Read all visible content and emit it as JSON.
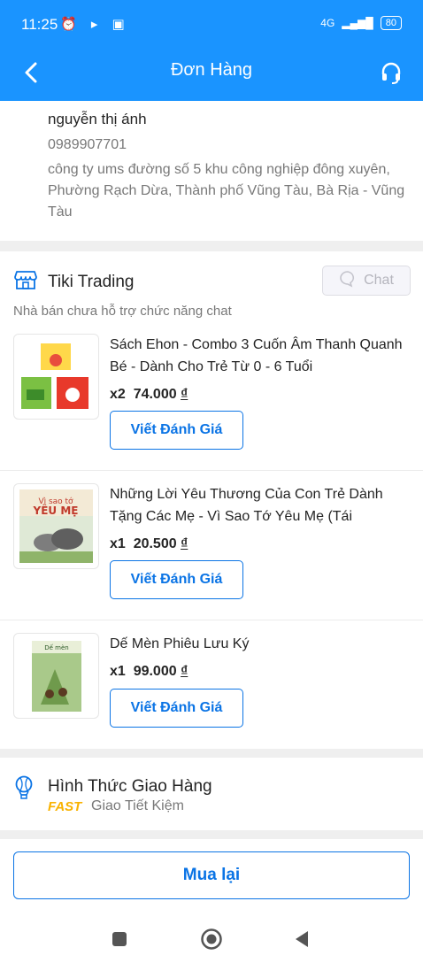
{
  "status_bar": {
    "time": "11:25",
    "battery": "80",
    "network": "4G"
  },
  "header": {
    "title": "Đơn Hàng"
  },
  "address": {
    "name": "nguyễn thị ánh",
    "phone": "0989907701",
    "full": "công ty ums đường số 5 khu công nghiệp đông xuyên, Phường Rạch Dừa, Thành phố Vũng Tàu, Bà Rịa - Vũng Tàu"
  },
  "seller": {
    "name": "Tiki Trading",
    "chat_label": "Chat",
    "note": "Nhà bán chưa hỗ trợ chức năng chat"
  },
  "items": [
    {
      "title": "Sách Ehon - Combo 3 Cuốn Âm Thanh Quanh Bé - Dành Cho Trẻ Từ 0 - 6 Tuổi",
      "qty": "x2",
      "price": "74.000",
      "currency": "₫",
      "review_label": "Viết Đánh Giá"
    },
    {
      "title": "Những Lời Yêu Thương Của Con Trẻ Dành Tặng Các Mẹ - Vì Sao Tớ Yêu Mẹ (Tái",
      "qty": "x1",
      "price": "20.500",
      "currency": "₫",
      "review_label": "Viết Đánh Giá"
    },
    {
      "title": "Dế Mèn Phiêu Lưu Ký",
      "qty": "x1",
      "price": "99.000",
      "currency": "₫",
      "review_label": "Viết Đánh Giá"
    }
  ],
  "shipping": {
    "title": "Hình Thức Giao Hàng",
    "badge": "FAST",
    "method": "Giao Tiết Kiệm"
  },
  "actions": {
    "buy_again": "Mua lại"
  },
  "colors": {
    "brand": "#1a94ff",
    "link": "#0b74e5",
    "fast": "#f9b200"
  },
  "icons": [
    "back-arrow-icon",
    "headset-icon",
    "store-icon",
    "chat-bubble-icon",
    "balloon-icon",
    "square-icon",
    "home-circle-icon",
    "triangle-back-icon"
  ]
}
